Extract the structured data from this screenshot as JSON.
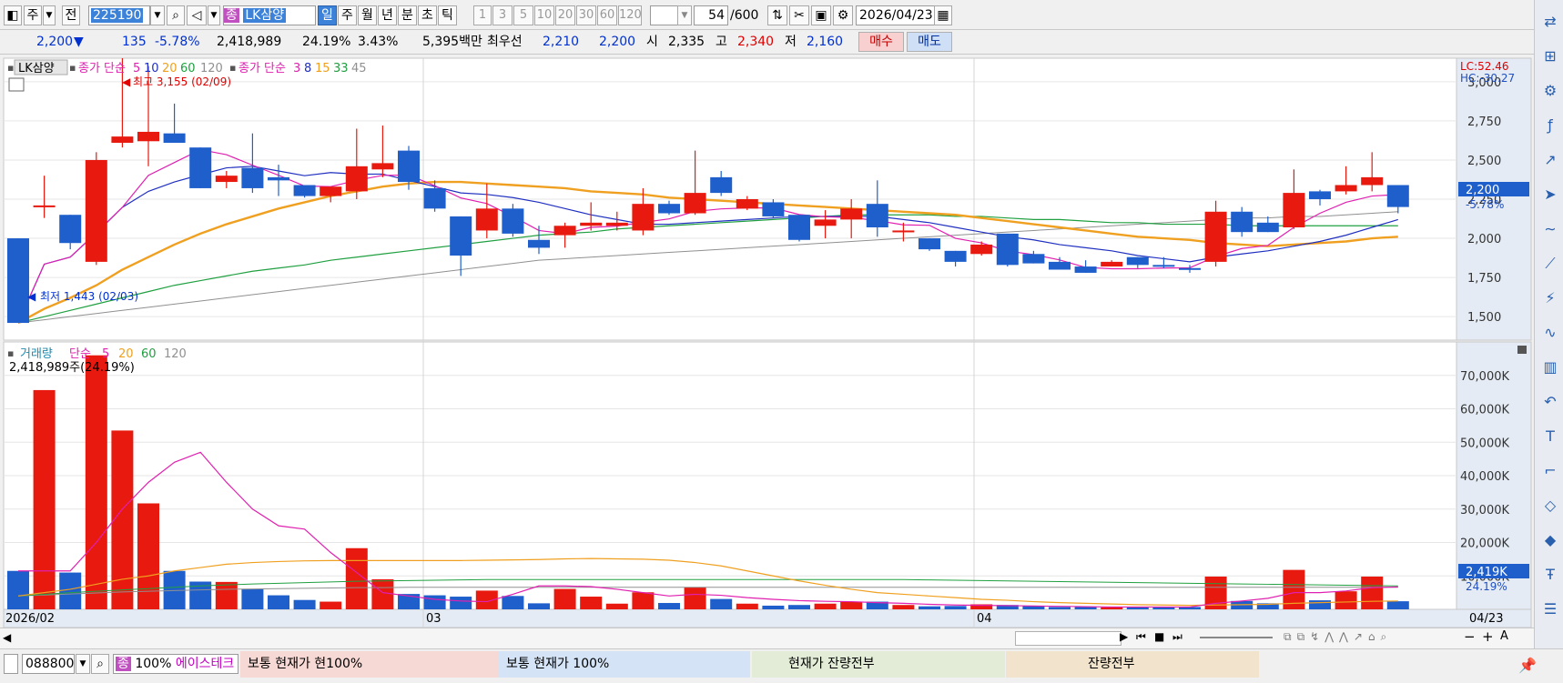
{
  "toolbar": {
    "period_left": "주",
    "prev": "전",
    "code": "225190",
    "stock_badge": "종",
    "stock_name": "LK삼양",
    "periods": [
      "일",
      "주",
      "월",
      "년",
      "분",
      "초",
      "틱"
    ],
    "intervals": [
      "1",
      "3",
      "5",
      "10",
      "20",
      "30",
      "60",
      "120"
    ],
    "count": "54",
    "count_total": "/600",
    "date": "2026/04/23"
  },
  "quote": {
    "price": "2,200",
    "arrow": "▼",
    "change": "135",
    "change_pct": "-5.78%",
    "volume": "2,418,989",
    "turnover_pct": "24.19%",
    "extra_pct": "3.43%",
    "amount": "5,395백만",
    "best_label": "최우선",
    "ask": "2,210",
    "bid": "2,200",
    "open_label": "시",
    "open": "2,335",
    "high_label": "고",
    "high": "2,340",
    "low_label": "저",
    "low": "2,160",
    "buy_label": "매수",
    "sell_label": "매도"
  },
  "price_panel": {
    "name_tag": "LK삼양",
    "ma1_label": "종가 단순",
    "ma1_periods": [
      "5",
      "10",
      "20",
      "60",
      "120"
    ],
    "ma2_label": "종가 단순",
    "ma2_periods": [
      "3",
      "8",
      "15",
      "33",
      "45"
    ],
    "high_note": "최고 3,155 (02/09)",
    "low_note": "최저 1,443 (02/03)",
    "lc": "LC:52.46",
    "hc": "HC:-30.27",
    "current_tag": "2,200",
    "current_pct": "-5.78%",
    "y_ticks": [
      "3,000",
      "2,750",
      "2,500",
      "2,250",
      "2,000",
      "1,750",
      "1,500"
    ]
  },
  "volume_panel": {
    "title": "거래량",
    "ma_label": "단순",
    "ma_periods": [
      "5",
      "20",
      "60",
      "120"
    ],
    "info": "2,418,989주(24.19%)",
    "current_tag": "2,419K",
    "current_pct": "24.19%",
    "y_ticks": [
      "70,000K",
      "60,000K",
      "50,000K",
      "40,000K",
      "30,000K",
      "20,000K",
      "10,000K"
    ]
  },
  "x_axis": {
    "labels": [
      "2026/02",
      "03",
      "04",
      "04/23"
    ]
  },
  "bottom": {
    "code": "088800",
    "badge": "종",
    "pct": "100%",
    "name": "에이스테크",
    "sections": [
      "보통   현재가   현100%",
      "보통   현재가    100%",
      "현재가    잔량전부",
      "잔량전부"
    ]
  },
  "colors": {
    "up": "#e8190e",
    "down": "#1f5fcc",
    "ma5": "#e020b0",
    "ma10": "#2030c0",
    "ma20": "#f0a020",
    "ma60": "#20a040",
    "ma120": "#909090"
  },
  "chart_data": {
    "type": "candlestick",
    "y_range": [
      1350,
      3150
    ],
    "candles": [
      {
        "o": 2000,
        "h": 2000,
        "l": 1460,
        "c": 1460
      },
      {
        "o": 2210,
        "h": 2400,
        "l": 2130,
        "c": 2210
      },
      {
        "o": 2150,
        "h": 2150,
        "l": 1930,
        "c": 1970
      },
      {
        "o": 1850,
        "h": 2550,
        "l": 1830,
        "c": 2500
      },
      {
        "o": 2610,
        "h": 3150,
        "l": 2580,
        "c": 2650
      },
      {
        "o": 2620,
        "h": 3100,
        "l": 2460,
        "c": 2680
      },
      {
        "o": 2670,
        "h": 2860,
        "l": 2620,
        "c": 2610
      },
      {
        "o": 2580,
        "h": 2580,
        "l": 2320,
        "c": 2320
      },
      {
        "o": 2360,
        "h": 2430,
        "l": 2320,
        "c": 2400
      },
      {
        "o": 2450,
        "h": 2670,
        "l": 2290,
        "c": 2320
      },
      {
        "o": 2390,
        "h": 2470,
        "l": 2270,
        "c": 2370
      },
      {
        "o": 2340,
        "h": 2340,
        "l": 2260,
        "c": 2270
      },
      {
        "o": 2270,
        "h": 2290,
        "l": 2230,
        "c": 2330
      },
      {
        "o": 2300,
        "h": 2700,
        "l": 2250,
        "c": 2460
      },
      {
        "o": 2440,
        "h": 2720,
        "l": 2390,
        "c": 2480
      },
      {
        "o": 2560,
        "h": 2590,
        "l": 2310,
        "c": 2360
      },
      {
        "o": 2320,
        "h": 2370,
        "l": 2170,
        "c": 2190
      },
      {
        "o": 2140,
        "h": 2140,
        "l": 1760,
        "c": 1890
      },
      {
        "o": 2050,
        "h": 2350,
        "l": 2000,
        "c": 2190
      },
      {
        "o": 2190,
        "h": 2220,
        "l": 2010,
        "c": 2030
      },
      {
        "o": 1990,
        "h": 2080,
        "l": 1900,
        "c": 1940
      },
      {
        "o": 2020,
        "h": 2100,
        "l": 1940,
        "c": 2080
      },
      {
        "o": 2080,
        "h": 2230,
        "l": 2050,
        "c": 2100
      },
      {
        "o": 2080,
        "h": 2170,
        "l": 2050,
        "c": 2100
      },
      {
        "o": 2050,
        "h": 2320,
        "l": 2020,
        "c": 2220
      },
      {
        "o": 2220,
        "h": 2240,
        "l": 2150,
        "c": 2160
      },
      {
        "o": 2160,
        "h": 2560,
        "l": 2150,
        "c": 2290
      },
      {
        "o": 2390,
        "h": 2430,
        "l": 2270,
        "c": 2290
      },
      {
        "o": 2190,
        "h": 2270,
        "l": 2180,
        "c": 2250
      },
      {
        "o": 2230,
        "h": 2250,
        "l": 2130,
        "c": 2140
      },
      {
        "o": 2150,
        "h": 2150,
        "l": 1980,
        "c": 1990
      },
      {
        "o": 2080,
        "h": 2180,
        "l": 2000,
        "c": 2120
      },
      {
        "o": 2120,
        "h": 2250,
        "l": 2000,
        "c": 2190
      },
      {
        "o": 2220,
        "h": 2370,
        "l": 2010,
        "c": 2070
      },
      {
        "o": 2050,
        "h": 2100,
        "l": 1980,
        "c": 2050
      },
      {
        "o": 2000,
        "h": 2000,
        "l": 1920,
        "c": 1930
      },
      {
        "o": 1920,
        "h": 1920,
        "l": 1820,
        "c": 1850
      },
      {
        "o": 1900,
        "h": 1980,
        "l": 1890,
        "c": 1960
      },
      {
        "o": 2030,
        "h": 2030,
        "l": 1820,
        "c": 1830
      },
      {
        "o": 1900,
        "h": 1920,
        "l": 1840,
        "c": 1840
      },
      {
        "o": 1850,
        "h": 1880,
        "l": 1800,
        "c": 1800
      },
      {
        "o": 1820,
        "h": 1860,
        "l": 1780,
        "c": 1780
      },
      {
        "o": 1820,
        "h": 1860,
        "l": 1820,
        "c": 1850
      },
      {
        "o": 1880,
        "h": 1880,
        "l": 1810,
        "c": 1830
      },
      {
        "o": 1830,
        "h": 1880,
        "l": 1810,
        "c": 1820
      },
      {
        "o": 1810,
        "h": 1830,
        "l": 1780,
        "c": 1800
      },
      {
        "o": 1850,
        "h": 2240,
        "l": 1820,
        "c": 2170
      },
      {
        "o": 2170,
        "h": 2200,
        "l": 2010,
        "c": 2040
      },
      {
        "o": 2100,
        "h": 2140,
        "l": 2040,
        "c": 2040
      },
      {
        "o": 2070,
        "h": 2440,
        "l": 2060,
        "c": 2290
      },
      {
        "o": 2300,
        "h": 2310,
        "l": 2210,
        "c": 2250
      },
      {
        "o": 2300,
        "h": 2460,
        "l": 2280,
        "c": 2340
      },
      {
        "o": 2340,
        "h": 2550,
        "l": 2300,
        "c": 2390
      },
      {
        "o": 2340,
        "h": 2340,
        "l": 2160,
        "c": 2200
      }
    ],
    "volume_range": [
      0,
      80000
    ],
    "volume": [
      11500,
      65600,
      11000,
      76000,
      53500,
      31700,
      11500,
      8300,
      8200,
      6000,
      4200,
      2800,
      2300,
      18300,
      9000,
      4600,
      4200,
      3800,
      5600,
      4000,
      1800,
      6100,
      3800,
      1700,
      5100,
      1900,
      6600,
      3100,
      1700,
      1100,
      1300,
      1700,
      2300,
      2300,
      1300,
      900,
      1000,
      1500,
      1300,
      1100,
      700,
      700,
      600,
      700,
      600,
      700,
      9800,
      2500,
      1800,
      11800,
      2700,
      5400,
      9800,
      2419
    ],
    "ma_lines": {
      "price_ma5": [
        1460,
        1835,
        1880,
        2035,
        2198,
        2402,
        2484,
        2566,
        2534,
        2467,
        2403,
        2334,
        2330,
        2370,
        2402,
        2404,
        2336,
        2258,
        2222,
        2140,
        2050,
        2030,
        2070,
        2078,
        2102,
        2124,
        2172,
        2188,
        2194,
        2194,
        2152,
        2137,
        2133,
        2113,
        2086,
        2083,
        2000,
        1971,
        1919,
        1896,
        1862,
        1814,
        1806,
        1806,
        1810,
        1812,
        1884,
        1935,
        1955,
        2070,
        2160,
        2230,
        2270,
        2280
      ],
      "price_ma10": [
        1460,
        1835,
        1880,
        2035,
        2198,
        2300,
        2360,
        2406,
        2450,
        2460,
        2430,
        2400,
        2420,
        2410,
        2410,
        2370,
        2330,
        2290,
        2280,
        2260,
        2230,
        2190,
        2150,
        2120,
        2090,
        2090,
        2100,
        2110,
        2120,
        2130,
        2140,
        2140,
        2140,
        2140,
        2120,
        2100,
        2070,
        2040,
        2010,
        1990,
        1960,
        1940,
        1920,
        1890,
        1870,
        1850,
        1880,
        1900,
        1920,
        1950,
        1980,
        2020,
        2070,
        2120
      ],
      "price_ma20": [
        1460,
        1550,
        1620,
        1700,
        1800,
        1880,
        1960,
        2030,
        2090,
        2140,
        2190,
        2230,
        2270,
        2300,
        2330,
        2350,
        2360,
        2360,
        2350,
        2340,
        2330,
        2320,
        2300,
        2290,
        2280,
        2260,
        2250,
        2240,
        2230,
        2220,
        2210,
        2200,
        2190,
        2180,
        2170,
        2160,
        2150,
        2130,
        2110,
        2090,
        2070,
        2050,
        2030,
        2010,
        2000,
        1990,
        1970,
        1960,
        1950,
        1960,
        1970,
        1980,
        2000,
        2010
      ],
      "price_ma60": [
        1460,
        1500,
        1540,
        1580,
        1620,
        1660,
        1700,
        1730,
        1760,
        1790,
        1810,
        1830,
        1860,
        1880,
        1900,
        1920,
        1940,
        1960,
        1980,
        2000,
        2020,
        2030,
        2040,
        2060,
        2070,
        2080,
        2090,
        2100,
        2110,
        2120,
        2130,
        2140,
        2150,
        2150,
        2150,
        2150,
        2140,
        2140,
        2130,
        2120,
        2120,
        2110,
        2100,
        2100,
        2090,
        2090,
        2090,
        2080,
        2080,
        2080,
        2080,
        2080,
        2080,
        2080
      ],
      "price_ma120": [
        1460,
        1480,
        1500,
        1520,
        1540,
        1560,
        1580,
        1600,
        1620,
        1640,
        1660,
        1680,
        1700,
        1720,
        1740,
        1760,
        1780,
        1800,
        1820,
        1840,
        1860,
        1870,
        1880,
        1890,
        1900,
        1910,
        1920,
        1930,
        1940,
        1950,
        1960,
        1970,
        1980,
        1990,
        2000,
        2010,
        2020,
        2030,
        2040,
        2050,
        2060,
        2070,
        2080,
        2090,
        2100,
        2110,
        2120,
        2130,
        2130,
        2140,
        2140,
        2150,
        2160,
        2170
      ],
      "vol_ma5": [
        11500,
        11500,
        11500,
        20000,
        30000,
        38000,
        44000,
        47000,
        38000,
        30000,
        25000,
        24000,
        17000,
        11000,
        5000,
        4000,
        3000,
        2500,
        2300,
        4500,
        7000,
        7000,
        6800,
        6000,
        5000,
        4000,
        4500,
        4200,
        3500,
        3000,
        2600,
        2400,
        2300,
        2000,
        1800,
        1500,
        1300,
        1200,
        1100,
        1000,
        900,
        800,
        700,
        700,
        700,
        700,
        1800,
        2500,
        3300,
        5000,
        5000,
        5500,
        6500,
        6700
      ],
      "vol_ma20": [
        4000,
        5000,
        6000,
        7500,
        9000,
        10000,
        11500,
        12500,
        13500,
        14000,
        14300,
        14500,
        14600,
        14600,
        14600,
        14600,
        14600,
        14600,
        14700,
        14800,
        14900,
        15100,
        15200,
        15100,
        15000,
        14700,
        14000,
        13000,
        11500,
        10000,
        8500,
        7200,
        6000,
        5000,
        4500,
        4000,
        3500,
        3000,
        2700,
        2300,
        2000,
        1800,
        1600,
        1400,
        1300,
        1200,
        1300,
        1400,
        1500,
        1800,
        2000,
        2200,
        2400,
        2500
      ],
      "vol_ma60": [
        4000,
        4500,
        5000,
        5400,
        5800,
        6200,
        6600,
        7000,
        7300,
        7600,
        7800,
        8000,
        8200,
        8400,
        8500,
        8600,
        8700,
        8800,
        8900,
        8900,
        8900,
        8900,
        8900,
        8900,
        8900,
        8900,
        8900,
        8900,
        8900,
        8900,
        8900,
        8900,
        8900,
        8900,
        8900,
        8800,
        8700,
        8600,
        8500,
        8400,
        8300,
        8200,
        8100,
        8000,
        7900,
        7800,
        7700,
        7600,
        7500,
        7400,
        7300,
        7200,
        7100,
        7000
      ],
      "vol_ma120": [
        4000,
        4300,
        4600,
        4900,
        5200,
        5400,
        5600,
        5800,
        6000,
        6100,
        6200,
        6300,
        6400,
        6500,
        6500,
        6600,
        6600,
        6600,
        6600,
        6600,
        6600,
        6600,
        6600,
        6600,
        6600,
        6600,
        6600,
        6600,
        6600,
        6600,
        6600,
        6600,
        6600,
        6600,
        6600,
        6600,
        6600,
        6600,
        6600,
        6600,
        6600,
        6600,
        6600,
        6600,
        6600,
        6600,
        6600,
        6600,
        6600,
        6600,
        6600,
        6600,
        6600,
        6600
      ]
    }
  }
}
